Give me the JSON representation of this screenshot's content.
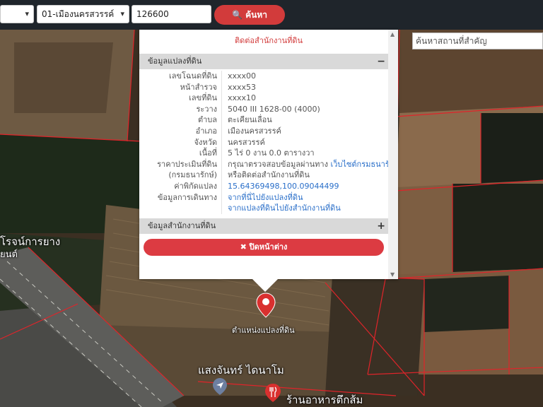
{
  "topbar": {
    "province_select": "",
    "amphoe_select": "01-เมืองนครสวรรค์",
    "parcel_input": "126600",
    "search_label": "ค้นหา"
  },
  "map": {
    "place_search_placeholder": "ค้นหาสถานที่สำคัญ",
    "labels": {
      "project_left": "โรจน์การยาง",
      "project_left_sub": "ยนต์",
      "parcel_marker_label": "ตำแหน่งแปลงที่ดิน",
      "bottom_place": "แสงจันทร์ ไดนาโม",
      "restaurant": "ร้านอาหารตึกส้ม"
    }
  },
  "popup": {
    "contact_top": "ติดต่อสำนักงานที่ดิน",
    "land_section_title": "ข้อมูลแปลงที่ดิน",
    "land_section_toggle": "−",
    "rows": [
      {
        "label": "เลขโฉนดที่ดิน",
        "value": "xxxx00"
      },
      {
        "label": "หน้าสำรวจ",
        "value": "xxxx53"
      },
      {
        "label": "เลขที่ดิน",
        "value": "xxxx10"
      },
      {
        "label": "ระวาง",
        "value": "5040 III 1628-00 (4000)"
      },
      {
        "label": "ตำบล",
        "value": "ตะเคียนเลื่อน"
      },
      {
        "label": "อำเภอ",
        "value": "เมืองนครสวรรค์"
      },
      {
        "label": "จังหวัด",
        "value": "นครสวรรค์"
      },
      {
        "label": "เนื้อที่",
        "value": "5 ไร่ 0 งาน 0.0 ตารางวา"
      },
      {
        "label": "ราคาประเมินที่ดิน",
        "value": "กรุณาตรวจสอบข้อมูลผ่านทาง",
        "value_link": "เว็บไซต์กรมธนารักษ์"
      },
      {
        "label": "(กรมธนารักษ์)",
        "value": "หรือติดต่อสำนักงานที่ดิน"
      },
      {
        "label": "ค่าพิกัดแปลง",
        "value_link": "15.64369498,100.09044499"
      },
      {
        "label": "ข้อมูลการเดินทาง",
        "value_link": "จากที่นี่ไปยังแปลงที่ดิน"
      },
      {
        "label": "",
        "value_link": "จากแปลงที่ดินไปยังสำนักงานที่ดิน"
      }
    ],
    "office_section_title": "ข้อมูลสำนักงานที่ดิน",
    "office_section_toggle": "+",
    "close_label": "✖ ปิดหน้าต่าง"
  },
  "colors": {
    "accent": "#d23b3b",
    "topbar": "#1f252b",
    "link": "#2a6fc9"
  }
}
